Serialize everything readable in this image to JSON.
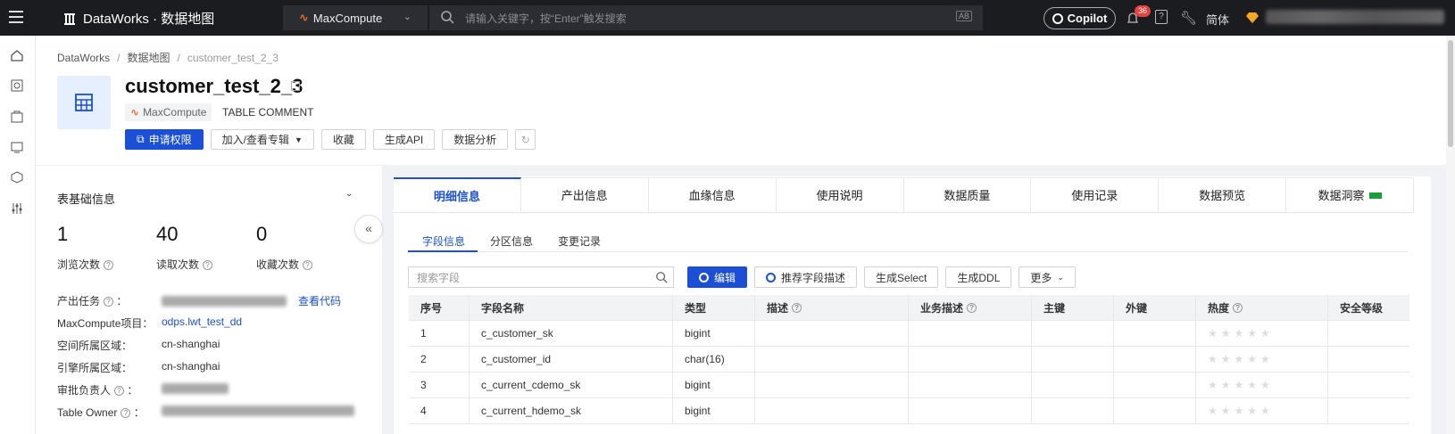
{
  "topbar": {
    "brand": "DataWorks · 数据地图",
    "product": "MaxCompute",
    "search_placeholder": "请输入关键字，按“Enter”触发搜索",
    "search_hint": "AB",
    "copilot": "Copilot",
    "notifications": "36",
    "help": "?",
    "language": "简体"
  },
  "breadcrumb": [
    "DataWorks",
    "数据地图",
    "customer_test_2_3"
  ],
  "table": {
    "name": "customer_test_2_3",
    "engine": "MaxCompute",
    "comment": "TABLE COMMENT"
  },
  "actions": {
    "apply": "申请权限",
    "album": "加入/查看专辑",
    "favorite": "收藏",
    "gen_api": "生成API",
    "analysis": "数据分析"
  },
  "basic": {
    "title": "表基础信息",
    "stats": [
      {
        "value": "1",
        "label": "浏览次数"
      },
      {
        "value": "40",
        "label": "读取次数"
      },
      {
        "value": "0",
        "label": "收藏次数"
      }
    ],
    "rows": [
      {
        "label": "产出任务",
        "value": "",
        "link": "查看代码"
      },
      {
        "label": "MaxCompute项目：",
        "value": "odps.lwt_test_dd"
      },
      {
        "label": "空间所属区域：",
        "value": "cn-shanghai"
      },
      {
        "label": "引擎所属区域：",
        "value": "cn-shanghai"
      },
      {
        "label": "审批负责人",
        "value": ""
      },
      {
        "label": "Table Owner",
        "value": ""
      }
    ]
  },
  "tabs": [
    "明细信息",
    "产出信息",
    "血缘信息",
    "使用说明",
    "数据质量",
    "使用记录",
    "数据预览",
    "数据洞察"
  ],
  "subtabs": [
    "字段信息",
    "分区信息",
    "变更记录"
  ],
  "field_search_placeholder": "搜索字段",
  "field_actions": {
    "edit": "编辑",
    "recommend": "推荐字段描述",
    "gen_select": "生成Select",
    "gen_ddl": "生成DDL",
    "more": "更多"
  },
  "columns": [
    "序号",
    "字段名称",
    "类型",
    "描述",
    "业务描述",
    "主键",
    "外键",
    "热度",
    "安全等级"
  ],
  "rows": [
    {
      "no": "1",
      "name": "c_customer_sk",
      "type": "bigint"
    },
    {
      "no": "2",
      "name": "c_customer_id",
      "type": "char(16)"
    },
    {
      "no": "3",
      "name": "c_current_cdemo_sk",
      "type": "bigint"
    },
    {
      "no": "4",
      "name": "c_current_hdemo_sk",
      "type": "bigint"
    }
  ],
  "colors": {
    "accent": "#1a4fd6",
    "topbar": "#1b1c20",
    "engine": "#f06b1f"
  }
}
